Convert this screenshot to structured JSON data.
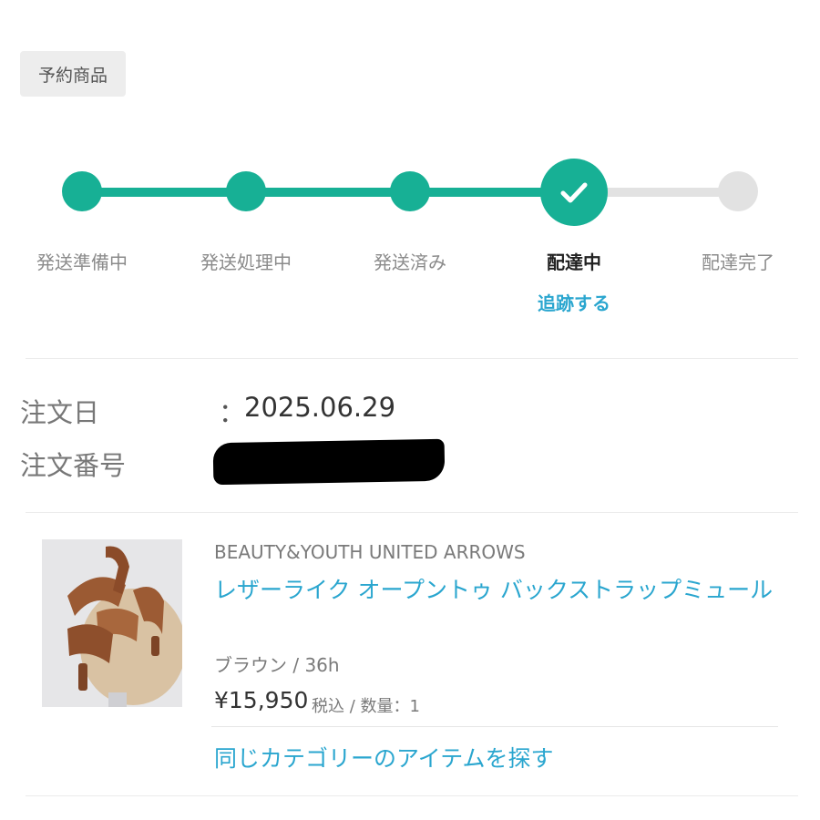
{
  "tag": {
    "label": "予約商品"
  },
  "progress": {
    "steps": [
      {
        "label": "発送準備中",
        "state": "done"
      },
      {
        "label": "発送処理中",
        "state": "done"
      },
      {
        "label": "発送済み",
        "state": "done"
      },
      {
        "label": "配達中",
        "state": "current"
      },
      {
        "label": "配達完了",
        "state": "todo"
      }
    ],
    "track_link": "追跡する",
    "current_icon": "check-icon"
  },
  "order": {
    "date_label": "注文日",
    "colon": "：",
    "date_value": "2025.06.29",
    "number_label": "注文番号"
  },
  "item": {
    "image_icon": "product-photo-sandals",
    "brand": "BEAUTY&YOUTH UNITED ARROWS",
    "name": "レザーライク オープントゥ バックストラップミュール",
    "variant": "ブラウン / 36h",
    "price": "¥15,950",
    "price_note": "税込 / 数量：1",
    "similar_link": "同じカテゴリーのアイテムを探す"
  },
  "colors": {
    "accent": "#17b095",
    "link": "#2aa6cf",
    "inactive": "#e2e2e2"
  }
}
